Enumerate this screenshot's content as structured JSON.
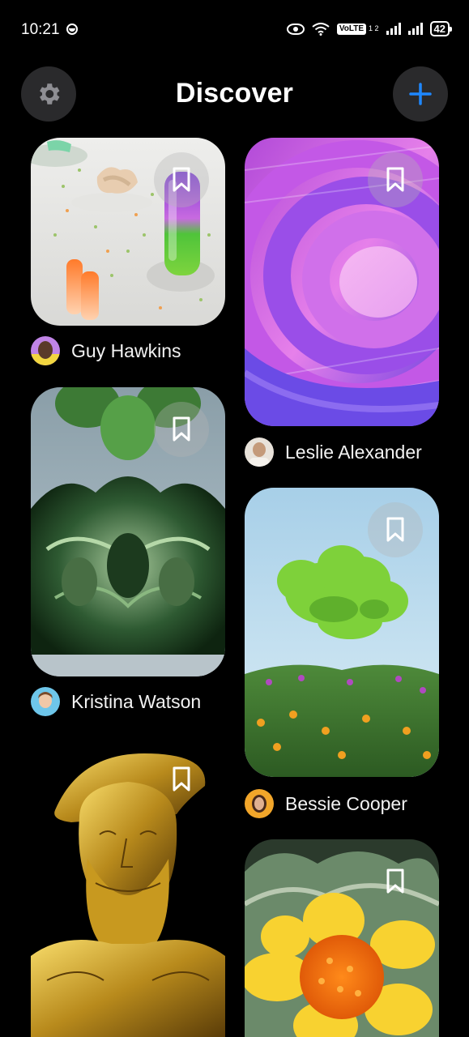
{
  "status_bar": {
    "time": "10:21",
    "network": "VoLTE",
    "network_sub": "1 2",
    "battery": "42"
  },
  "header": {
    "title": "Discover"
  },
  "accent": "#1e88ff",
  "posts": [
    {
      "author": "Guy Hawkins",
      "artwork": "test-tubes-still-life",
      "bookmark_icon": "bookmark-icon"
    },
    {
      "author": "Leslie Alexander",
      "artwork": "purple-spiral-tunnel",
      "bookmark_icon": "bookmark-icon"
    },
    {
      "author": "Kristina Watson",
      "artwork": "green-chrome-sculpture",
      "bookmark_icon": "bookmark-icon"
    },
    {
      "author": "Bessie Cooper",
      "artwork": "green-cloud-meadow",
      "bookmark_icon": "bookmark-icon"
    },
    {
      "author": "",
      "artwork": "golden-bust",
      "bookmark_icon": "bookmark-icon"
    },
    {
      "author": "",
      "artwork": "yellow-flower",
      "bookmark_icon": "bookmark-icon"
    }
  ]
}
